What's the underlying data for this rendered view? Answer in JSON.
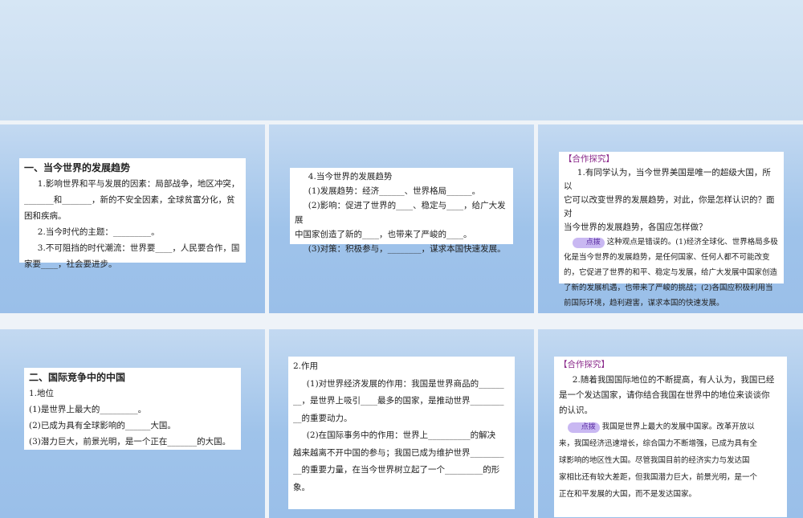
{
  "slide1": {
    "heading": "一、当今世界的发展趋势",
    "lines": [
      "1.影响世界和平与发展的因素：局部战争，地区冲突，",
      "_______和_______，新的不安全因素，全球贫富分化，贫",
      "困和疾病。",
      "2.当今时代的主题：_________。",
      "3.不可阻挡的时代潮流：世界要____，人民要合作，国",
      "家要____，社会要进步。"
    ]
  },
  "slide2": {
    "lines": [
      "4.当今世界的发展趋势",
      "(1)发展趋势：经济______、世界格局______。",
      "(2)影响：促进了世界的____、稳定与____，给广大发展",
      "中国家创造了新的____，也带来了严峻的____。",
      "(3)对策：积极参与，________，谋求本国快速发展。"
    ]
  },
  "slide3": {
    "tag": "【合作探究】",
    "question": [
      "1.有同学认为，当今世界美国是唯一的超级大国，所以",
      "它可以改变世界的发展趋势，对此，你是怎样认识的？面对",
      "当今世界的发展趋势，各国应怎样做？"
    ],
    "hint_label": "点拨",
    "answer": [
      "这种观点是错误的。(1)经济全球化、世界格局多极",
      "化是当今世界的发展趋势，是任何国家、任何人都不可能改变",
      "的，它促进了世界的和平、稳定与发展，给广大发展中国家创造",
      "了新的发展机遇，也带来了严峻的挑战；(2)各国应积极利用当",
      "前国际环境，趋利避害，谋求本国的快速发展。"
    ]
  },
  "slide4": {
    "heading": "二、国际竞争中的中国",
    "lines": [
      "1.地位",
      "(1)是世界上最大的_________。",
      "(2)已成为具有全球影响的______大国。",
      "(3)潜力巨大，前景光明，是一个正在_______的大国。"
    ]
  },
  "slide5": {
    "lines": [
      "2.作用",
      "(1)对世界经济发展的作用：我国是世界商品的______",
      "__，是世界上吸引____最多的国家，是推动世界________",
      "__的重要动力。",
      "(2)在国际事务中的作用：世界上__________的解决",
      "越来越离不开中国的参与；我国已成为维护世界________",
      "__的重要力量，在当今世界树立起了一个_________的形",
      "象。"
    ]
  },
  "slide6": {
    "tag": "【合作探究】",
    "question": [
      "2.随着我国国际地位的不断提高，有人认为，我国已经",
      "是一个发达国家，请你结合我国在世界中的地位来谈谈你",
      "的认识。"
    ],
    "hint_label": "点拨",
    "answer": [
      "我国是世界上最大的发展中国家。改革开放以",
      "来，我国经济迅速增长，综合国力不断增强，已成为具有全",
      "球影响的地区性大国。尽管我国目前的经济实力与发达国",
      "家相比还有较大差距，但我国潜力巨大，前景光明，是一个",
      "正在和平发展的大国，而不是发达国家。"
    ]
  }
}
